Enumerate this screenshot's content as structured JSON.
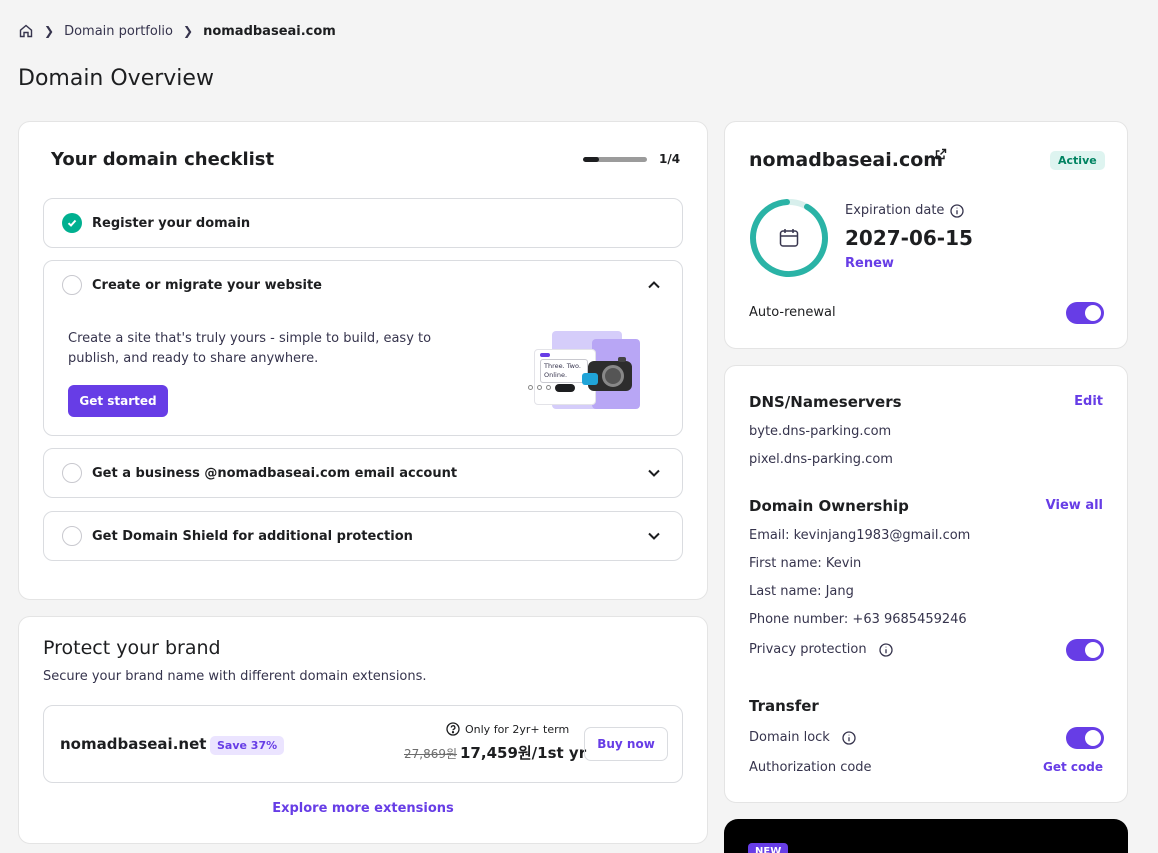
{
  "breadcrumb": {
    "items": [
      "Domain portfolio",
      "nomadbaseai.com"
    ]
  },
  "page_title": "Domain Overview",
  "checklist": {
    "title": "Your domain checklist",
    "progress_text": "1/4",
    "progress_fraction": 0.25,
    "items": [
      {
        "label": "Register your domain",
        "done": true
      },
      {
        "label": "Create or migrate your website",
        "done": false,
        "expanded": true,
        "description": "Create a site that's truly yours - simple to build, easy to publish, and ready to share anywhere.",
        "button": "Get started",
        "illustration_text": "Three. Two. Online."
      },
      {
        "label": "Get a business @nomadbaseai.com email account",
        "done": false
      },
      {
        "label": "Get Domain Shield for additional protection",
        "done": false
      }
    ]
  },
  "brand": {
    "title": "Protect your brand",
    "subtitle": "Secure your brand name with different domain extensions.",
    "offer": {
      "domain": "nomadbaseai.net",
      "badge": "Save 37%",
      "note": "Only for 2yr+ term",
      "old_price": "27,869원",
      "price": "17,459원/1st yr",
      "button": "Buy now"
    },
    "explore_link": "Explore more extensions"
  },
  "domain": {
    "name": "nomadbaseai.com",
    "status": "Active",
    "expiration_label": "Expiration date",
    "expiration_date": "2027-06-15",
    "renew_link": "Renew",
    "auto_renewal_label": "Auto-renewal",
    "auto_renewal_on": true
  },
  "dns": {
    "title": "DNS/Nameservers",
    "edit_link": "Edit",
    "nameservers": [
      "byte.dns-parking.com",
      "pixel.dns-parking.com"
    ],
    "ownership_title": "Domain Ownership",
    "view_all_link": "View all",
    "email": "Email: kevinjang1983@gmail.com",
    "first_name": "First name: Kevin",
    "last_name": "Last name: Jang",
    "phone": "Phone number: +63 9685459246",
    "privacy_label": "Privacy protection",
    "privacy_on": true,
    "transfer_title": "Transfer",
    "lock_label": "Domain lock",
    "lock_on": true,
    "auth_label": "Authorization code",
    "get_code_link": "Get code"
  },
  "promo": {
    "badge": "NEW"
  },
  "colors": {
    "accent": "#673de6",
    "success": "#00b090",
    "ring": "#2ab3a6"
  }
}
